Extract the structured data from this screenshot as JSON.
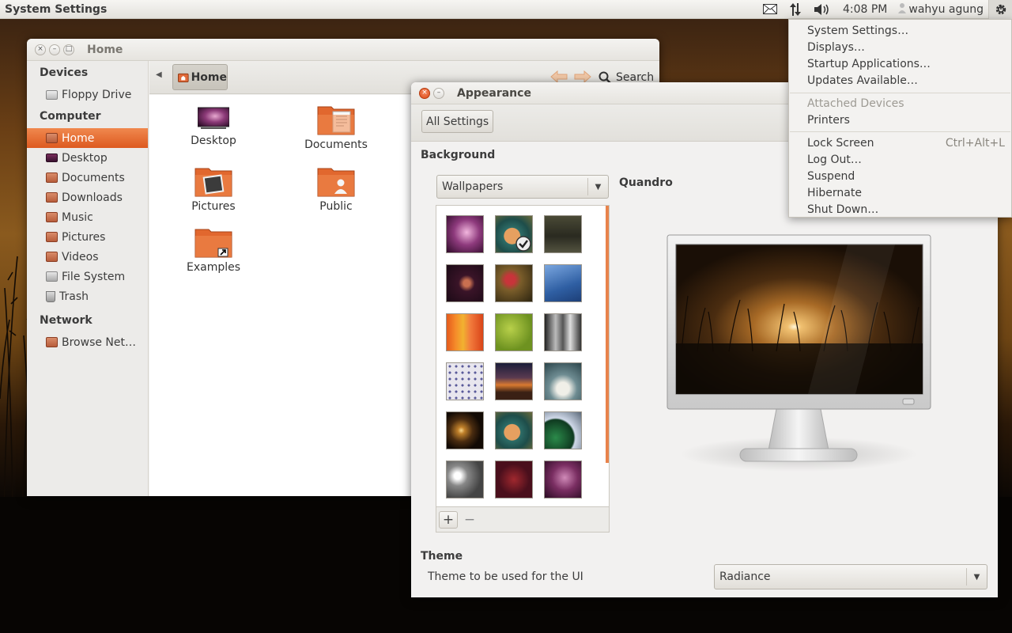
{
  "panel": {
    "app_title": "System Settings",
    "time": "4:08 PM",
    "user": "wahyu agung",
    "icons": [
      "mail-icon",
      "network-icon",
      "volume-icon",
      "user-icon",
      "session-gear-icon"
    ]
  },
  "files_window": {
    "title": "Home",
    "sidebar": {
      "sections": [
        {
          "header": "Devices",
          "items": [
            {
              "label": "Floppy Drive",
              "icon": "floppy-drive-icon"
            }
          ]
        },
        {
          "header": "Computer",
          "items": [
            {
              "label": "Home",
              "icon": "home-folder-icon",
              "active": true
            },
            {
              "label": "Desktop",
              "icon": "desktop-folder-icon"
            },
            {
              "label": "Documents",
              "icon": "documents-folder-icon"
            },
            {
              "label": "Downloads",
              "icon": "downloads-folder-icon"
            },
            {
              "label": "Music",
              "icon": "music-folder-icon"
            },
            {
              "label": "Pictures",
              "icon": "pictures-folder-icon"
            },
            {
              "label": "Videos",
              "icon": "videos-folder-icon"
            },
            {
              "label": "File System",
              "icon": "file-system-icon"
            },
            {
              "label": "Trash",
              "icon": "trash-icon"
            }
          ]
        },
        {
          "header": "Network",
          "items": [
            {
              "label": "Browse Net…",
              "icon": "network-icon"
            }
          ]
        }
      ]
    },
    "path_button": "Home",
    "search_label": "Search",
    "items": [
      {
        "label": "Desktop",
        "icon": "desktop-folder-icon"
      },
      {
        "label": "Documents",
        "icon": "documents-folder-icon"
      },
      {
        "label": "Pictures",
        "icon": "pictures-folder-icon"
      },
      {
        "label": "Public",
        "icon": "public-folder-icon"
      },
      {
        "label": "Examples",
        "icon": "examples-folder-icon"
      }
    ]
  },
  "appearance_window": {
    "title": "Appearance",
    "all_settings_label": "All Settings",
    "background_heading": "Background",
    "wallpaper_source": "Wallpapers",
    "selected_wallpaper": "Quandro",
    "add_label": "+",
    "remove_label": "−",
    "theme_heading": "Theme",
    "theme_description": "Theme to be used for the UI",
    "theme_value": "Radiance",
    "colors": {
      "accent": "#dd4814",
      "scrollbar": "#e8834b"
    }
  },
  "session_menu": {
    "groups": [
      [
        {
          "label": "System Settings…"
        },
        {
          "label": "Displays…"
        },
        {
          "label": "Startup Applications…"
        },
        {
          "label": "Updates Available…"
        }
      ],
      [
        {
          "label": "Attached Devices",
          "disabled": true
        },
        {
          "label": "Printers"
        }
      ],
      [
        {
          "label": "Lock Screen",
          "shortcut": "Ctrl+Alt+L"
        },
        {
          "label": "Log Out…"
        },
        {
          "label": "Suspend"
        },
        {
          "label": "Hibernate"
        },
        {
          "label": "Shut Down…"
        }
      ]
    ]
  }
}
